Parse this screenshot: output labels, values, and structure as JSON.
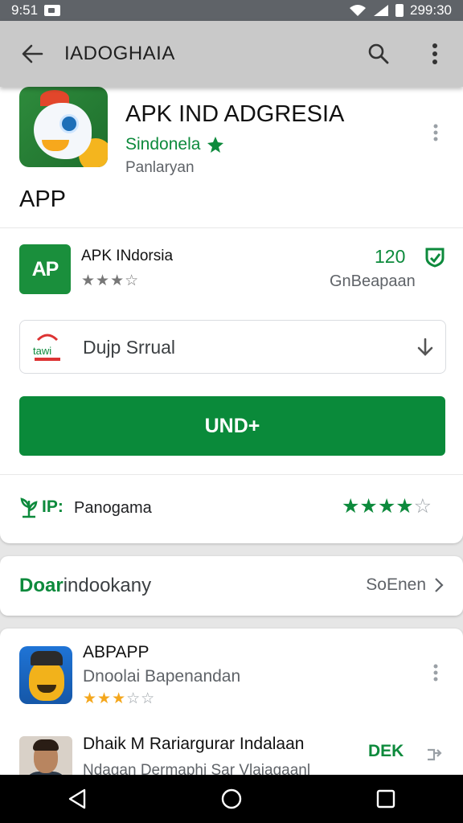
{
  "status_bar": {
    "left_time": "9:51",
    "right_time": "299:30"
  },
  "app_bar": {
    "title": "IADOGHAIA",
    "icons": [
      "back-arrow-icon",
      "search-icon",
      "more-vert-icon"
    ]
  },
  "hero": {
    "title": "APK IND ADGRESIA",
    "developer": "Sindonela",
    "category": "Panlaryan",
    "section_label": "APP"
  },
  "featured_row": {
    "icon_text": "AP",
    "name": "APK INdorsia",
    "rating_stars": "★★★☆",
    "count": "120",
    "subtitle": "GnBeapaan"
  },
  "download_box": {
    "text": "Dujp Srrual",
    "logo_text": "tawi"
  },
  "install_button": {
    "label": "UND+"
  },
  "tip_row": {
    "label": "IP:",
    "text": "Panogama",
    "rating_full": "★★★★",
    "rating_empty": "☆",
    "rating": 4.5
  },
  "section2": {
    "title_highlight": "Doar",
    "title_rest": "indookany",
    "more_label": "SoEnen"
  },
  "list": [
    {
      "name": "ABPAPP",
      "developer": "Dnoolai Bapenandan",
      "stars_full": "★★★",
      "stars_empty": "☆☆",
      "rating": 3
    },
    {
      "name": "Dhaik M Rariargurar Indalaan",
      "subtitle": "Ndagan Dermaphi Sar Vlajagaanl",
      "tag": "DEK"
    }
  ],
  "colors": {
    "brand_green": "#0a8a3a",
    "text_green": "#0d8a3c",
    "star_orange": "#f4a71d"
  }
}
